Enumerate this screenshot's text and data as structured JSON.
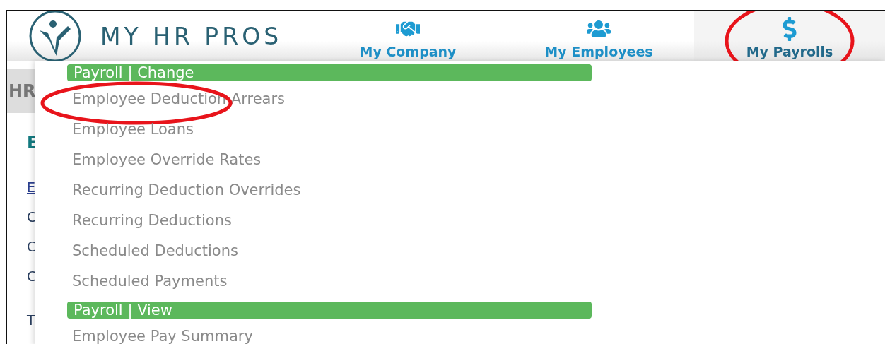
{
  "brand": {
    "name": "MY HR PROS"
  },
  "nav": [
    {
      "label": "My Company",
      "selected": false,
      "circled": false
    },
    {
      "label": "My Employees",
      "selected": false,
      "circled": false
    },
    {
      "label": "My Payrolls",
      "selected": true,
      "circled": true
    }
  ],
  "background_page": {
    "title": "HR",
    "heading": "E",
    "link": "E",
    "lines": [
      "C",
      "C",
      "C"
    ],
    "footer": "T"
  },
  "menu": [
    {
      "kind": "header",
      "label": "Payroll | Change"
    },
    {
      "kind": "item",
      "label": "Employee Deduction Arrears",
      "circled": true
    },
    {
      "kind": "item",
      "label": "Employee Loans",
      "circled": false
    },
    {
      "kind": "item",
      "label": "Employee Override Rates",
      "circled": false
    },
    {
      "kind": "item",
      "label": "Recurring Deduction Overrides",
      "circled": false
    },
    {
      "kind": "item",
      "label": "Recurring Deductions",
      "circled": false
    },
    {
      "kind": "item",
      "label": "Scheduled Deductions",
      "circled": false
    },
    {
      "kind": "item",
      "label": "Scheduled Payments",
      "circled": false
    },
    {
      "kind": "header",
      "label": "Payroll | View"
    },
    {
      "kind": "item",
      "label": "Employee Pay Summary",
      "circled": false
    }
  ]
}
